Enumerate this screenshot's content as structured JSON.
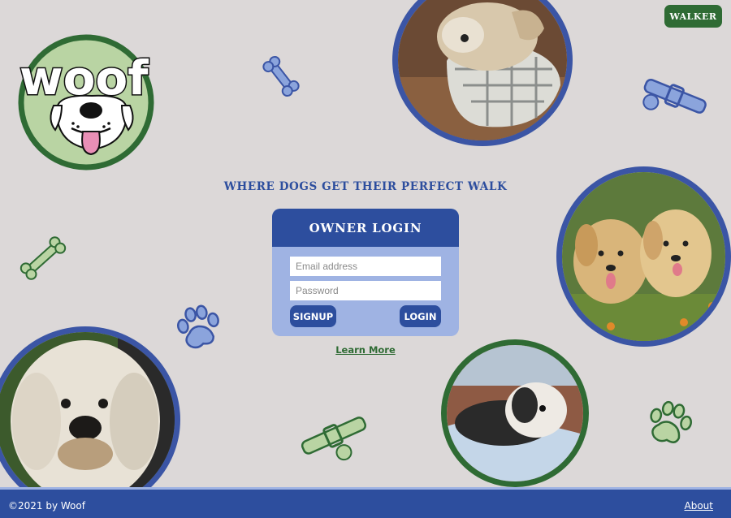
{
  "header": {
    "walker_label": "WALKER"
  },
  "logo": {
    "text": "woof"
  },
  "main": {
    "tagline": "WHERE DOGS GET THEIR PERFECT WALK",
    "login": {
      "title": "OWNER LOGIN",
      "email_placeholder": "Email address",
      "password_placeholder": "Password",
      "signup_label": "SIGNUP",
      "login_label": "LOGIN"
    },
    "learn_more": "Learn More"
  },
  "footer": {
    "copyright": "©2021 by Woof",
    "about": "About"
  },
  "colors": {
    "blue": "#2d4e9e",
    "green": "#2f6b34",
    "light_blue": "#9fb3e3",
    "background": "#dcd8d8"
  },
  "icons": [
    "bone-icon",
    "collar-icon",
    "paw-icon"
  ]
}
